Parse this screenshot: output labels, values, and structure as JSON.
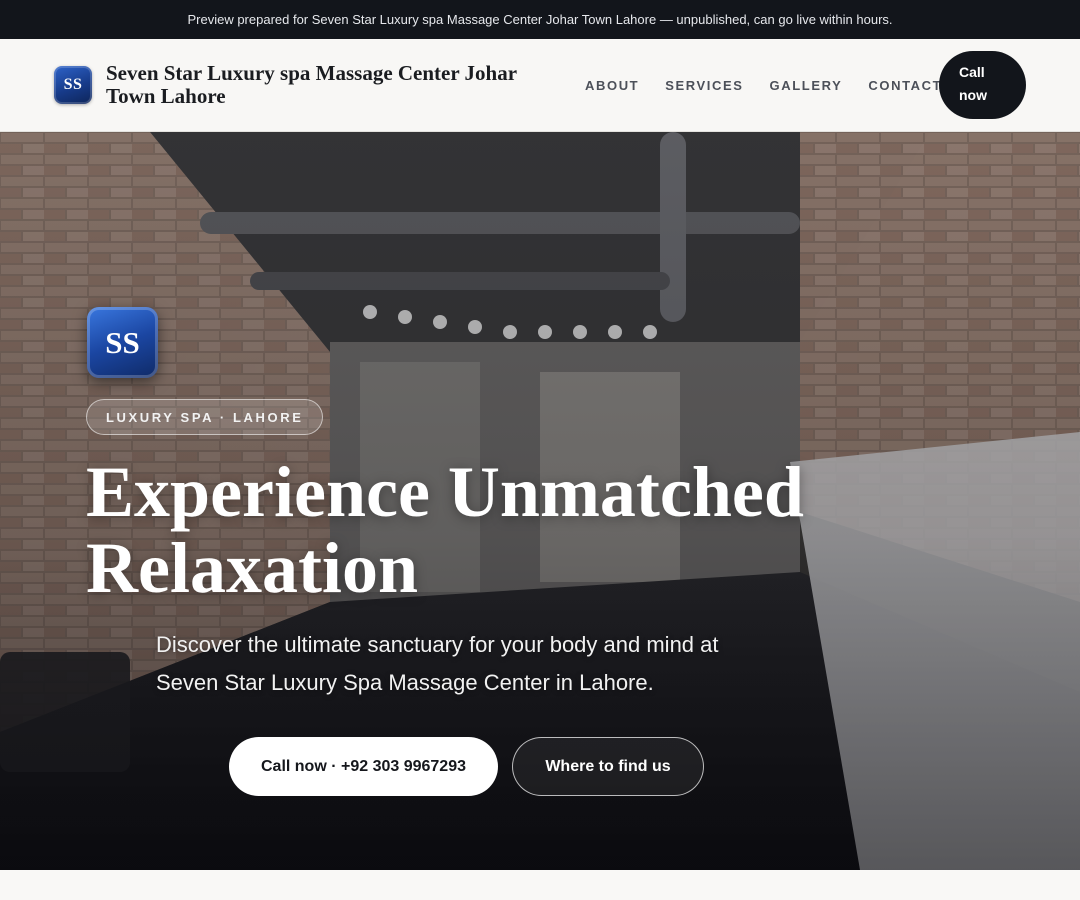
{
  "banner": {
    "text": "Preview prepared for Seven Star Luxury spa Massage Center Johar Town Lahore — unpublished, can go live within hours."
  },
  "header": {
    "logo_initials": "SS",
    "brand_name": "Seven Star Luxury spa Massage Center Johar Town Lahore",
    "nav": [
      {
        "label": "ABOUT"
      },
      {
        "label": "SERVICES"
      },
      {
        "label": "GALLERY"
      },
      {
        "label": "CONTACT"
      }
    ],
    "call_label": "Call now"
  },
  "hero": {
    "logo_initials": "SS",
    "tag": "LUXURY SPA · LAHORE",
    "headline": "Experience Unmatched Relaxation",
    "subtext": "Discover the ultimate sanctuary for your body and mind at Seven Star Luxury Spa Massage Center in Lahore.",
    "primary_cta": "Call now · +92 303 9967293",
    "secondary_cta": "Where to find us"
  },
  "colors": {
    "dark": "#12151b",
    "brand_blue": "#1b46a2",
    "surface": "#f9f8f6"
  }
}
